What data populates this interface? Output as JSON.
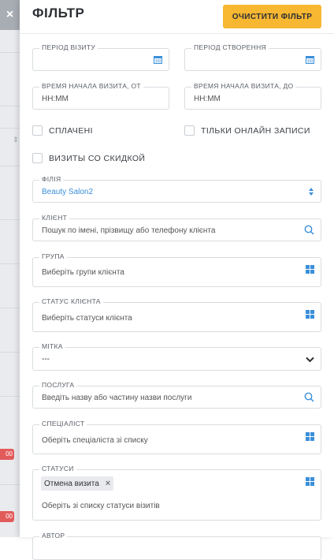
{
  "close_label": "×",
  "header": {
    "title": "ФІЛЬТР",
    "clear_button": "ОЧИСТИТИ ФІЛЬТР"
  },
  "visit_period": {
    "label": "ПЕРІОД ВІЗИТУ",
    "value": ""
  },
  "creation_period": {
    "label": "ПЕРІОД СТВОРЕННЯ",
    "value": ""
  },
  "time_from": {
    "label": "ВРЕМЯ НАЧАЛА ВИЗИТА, ОТ",
    "placeholder": "HH:MM"
  },
  "time_to": {
    "label": "ВРЕМЯ НАЧАЛА ВИЗИТА, ДО",
    "placeholder": "HH:MM"
  },
  "checkboxes": {
    "paid": "СПЛАЧЕНІ",
    "online_only": "ТІЛЬКИ ОНЛАЙН ЗАПИСИ",
    "discount": "ВИЗИТЫ СО СКИДКОЙ"
  },
  "branch": {
    "label": "ФІЛІЯ",
    "value": "Beauty Salon2"
  },
  "client": {
    "label": "КЛІЄНТ",
    "placeholder": "Пошук по імені, прізвищу або телефону клієнта"
  },
  "group": {
    "label": "ГРУПА",
    "placeholder": "Виберіть групи клієнта"
  },
  "client_status": {
    "label": "СТАТУС КЛІЄНТА",
    "placeholder": "Виберіть статуси клієнта"
  },
  "tag": {
    "label": "МІТКА",
    "value": "---"
  },
  "service": {
    "label": "ПОСЛУГА",
    "placeholder": "Введіть назву або частину назви послуги"
  },
  "specialist": {
    "label": "СПЕЦІАЛІСТ",
    "placeholder": "Оберіть спеціаліста зі списку"
  },
  "statuses": {
    "label": "СТАТУСИ",
    "chip": "Отмена визита",
    "chip_remove": "×",
    "placeholder": "Оберіть зі списку статуси візитів"
  },
  "author": {
    "label": "АВТОР"
  },
  "strip": {
    "sort_icon": "⇕",
    "badges": [
      "00",
      "00"
    ]
  },
  "colors": {
    "accent": "#f7b731",
    "link": "#3a8fd9",
    "badge": "#e25b5b"
  }
}
